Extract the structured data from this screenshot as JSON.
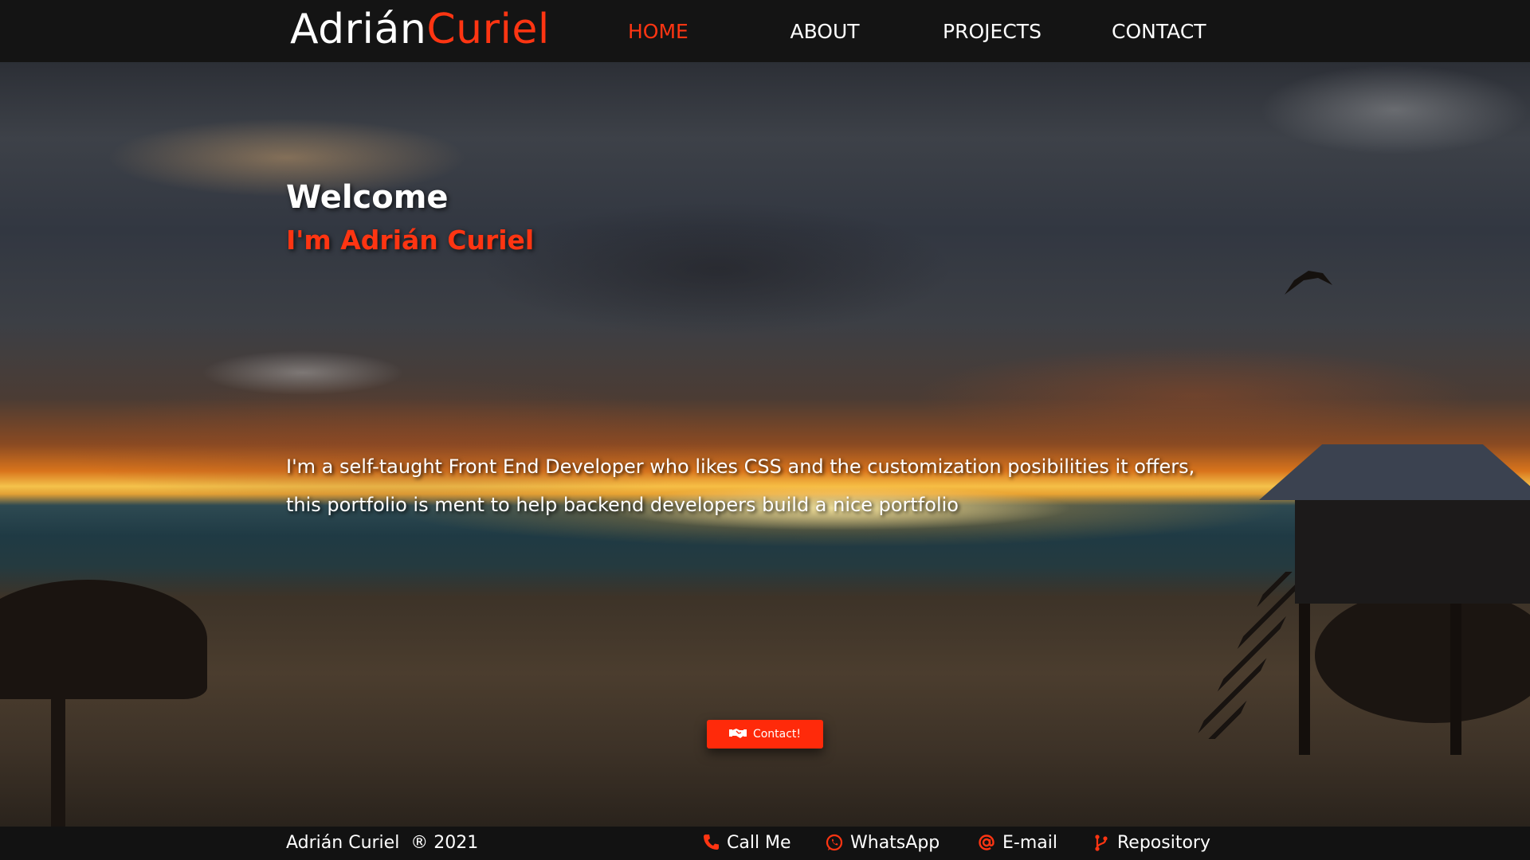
{
  "logo": {
    "first": "Adrián",
    "last": "Curiel"
  },
  "nav": {
    "items": [
      {
        "label": "HOME",
        "active": true
      },
      {
        "label": "ABOUT",
        "active": false
      },
      {
        "label": "PROJECTS",
        "active": false
      },
      {
        "label": "CONTACT",
        "active": false
      }
    ]
  },
  "hero": {
    "welcome": "Welcome",
    "subtitle": "I'm Adrián Curiel",
    "bio_lines": [
      "I'm a self-taught Front End Developer who likes CSS and the customization posibilities it offers,",
      "this portfolio is ment to help backend developers build a nice portfolio"
    ],
    "contact_button": {
      "label": "Contact!",
      "icon": "handshake-icon"
    }
  },
  "footer": {
    "copyright": "Adrián Curiel  ® 2021",
    "links": [
      {
        "label": "Call Me",
        "icon": "phone-icon"
      },
      {
        "label": "WhatsApp",
        "icon": "whatsapp-icon"
      },
      {
        "label": "E-mail",
        "icon": "at-sign-icon"
      },
      {
        "label": "Repository",
        "icon": "git-branch-icon"
      }
    ]
  },
  "colors": {
    "accent": "#ff3512",
    "navbar": "#141414",
    "text": "#ffffff"
  }
}
